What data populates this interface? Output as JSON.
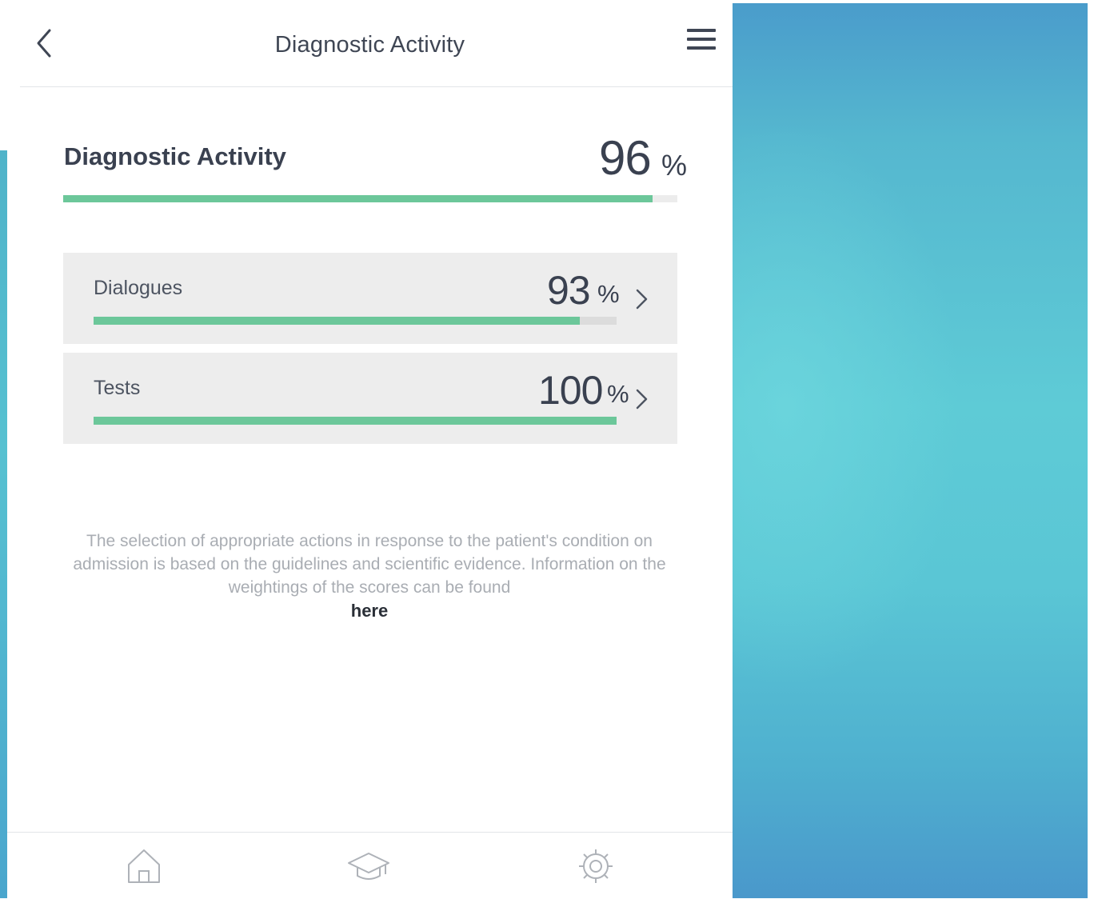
{
  "header": {
    "title": "Diagnostic Activity",
    "back_icon": "chevron-left-icon",
    "menu_icon": "hamburger-menu-icon"
  },
  "summary": {
    "title": "Diagnostic Activity",
    "value": "96",
    "unit": "%",
    "progress_percent": 96
  },
  "items": [
    {
      "label": "Dialogues",
      "value": "93",
      "unit": "%",
      "progress_percent": 93,
      "icon": "chevron-right-icon"
    },
    {
      "label": "Tests",
      "value": "100",
      "unit": "%",
      "progress_percent": 100,
      "icon": "chevron-right-icon"
    }
  ],
  "note": {
    "text": "The selection of appropriate actions in response to the patient's condition on admission is based on the guidelines and scientific evidence. Information on the weightings of the scores can be found",
    "link_label": "here"
  },
  "bottom_nav": {
    "items": [
      {
        "icon": "home-icon"
      },
      {
        "icon": "graduation-cap-icon"
      },
      {
        "icon": "gear-icon"
      }
    ]
  },
  "colors": {
    "accent": "#6cc79a",
    "track": "#ececec",
    "card_bg": "#ededed",
    "side_panel": "#5ecbd6"
  }
}
